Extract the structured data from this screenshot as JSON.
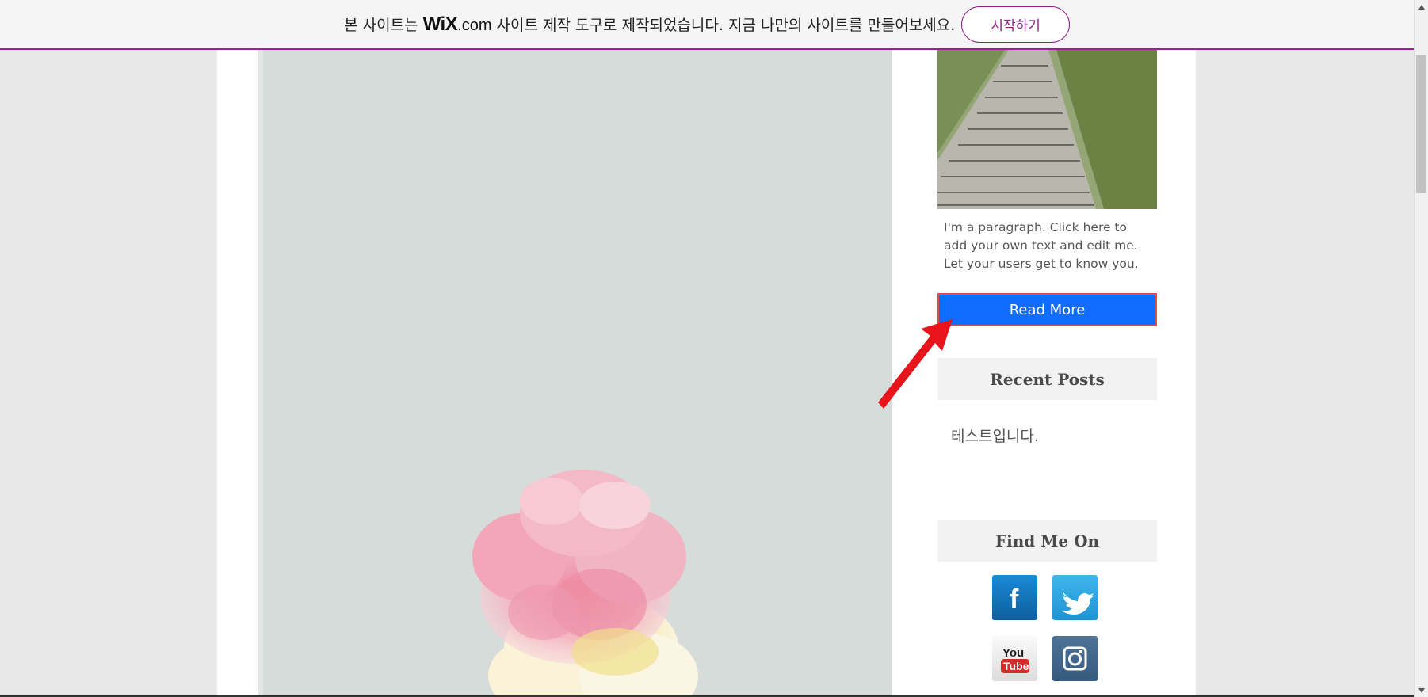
{
  "banner": {
    "message_before": "본 사이트는",
    "logo_wix": "WiX",
    "logo_com": ".com",
    "message_after": "사이트 제작 도구로 제작되었습니다. 지금 나만의 사이트를 만들어보세요.",
    "start_button": "시작하기",
    "accent_color": "#8d1f86"
  },
  "sidebar": {
    "paragraph": "I'm a paragraph. Click here to\nadd your own text and edit me.\nLet your users get to know you.",
    "read_more": "Read More",
    "recent_posts_title": "Recent Posts",
    "recent_posts": [
      "테스트입니다."
    ],
    "find_me_title": "Find Me On",
    "social": [
      "facebook-icon",
      "twitter-icon",
      "youtube-icon",
      "instagram-icon"
    ]
  },
  "colors": {
    "read_more_bg": "#116dff",
    "annotation_arrow": "#e8141b"
  }
}
